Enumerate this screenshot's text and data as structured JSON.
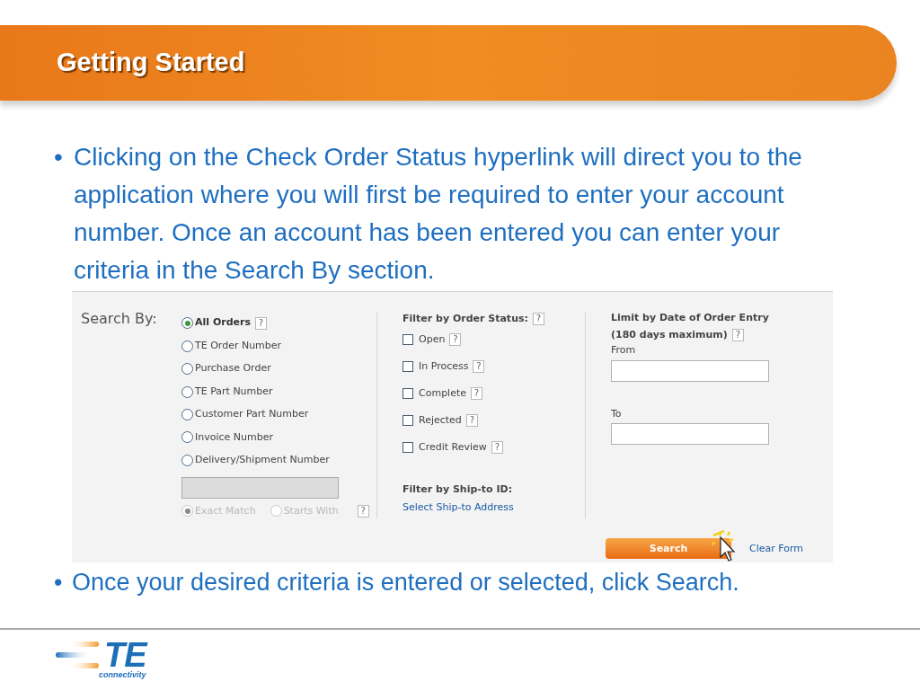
{
  "title": "Getting Started",
  "bullets": [
    {
      "mark": "•",
      "text": "Clicking on the Check Order Status hyperlink will direct you to the application where you will first be required to enter your account number.  Once an account has been entered you can enter your criteria in the Search By section."
    },
    {
      "mark": "•",
      "text": "Once your desired criteria is entered or selected, click Search."
    }
  ],
  "form": {
    "search_by": {
      "label": "Search By:",
      "options": [
        {
          "label": "All Orders",
          "selected": true,
          "help": "?"
        },
        {
          "label": "TE Order Number",
          "selected": false
        },
        {
          "label": "Purchase Order",
          "selected": false
        },
        {
          "label": "TE Part Number",
          "selected": false
        },
        {
          "label": "Customer Part Number",
          "selected": false
        },
        {
          "label": "Invoice Number",
          "selected": false
        },
        {
          "label": "Delivery/Shipment Number",
          "selected": false
        }
      ],
      "field": {
        "disabled": true
      },
      "match": {
        "disabled": true,
        "help": "?",
        "options": [
          {
            "label": "Exact Match",
            "selected": true
          },
          {
            "label": "Starts With",
            "selected": false
          }
        ]
      }
    },
    "status": {
      "label": "Filter by Order Status:",
      "help": "?",
      "options": [
        {
          "label": "Open",
          "checked": false,
          "help": "?"
        },
        {
          "label": "In Process",
          "checked": false,
          "help": "?"
        },
        {
          "label": "Complete",
          "checked": false,
          "help": "?"
        },
        {
          "label": "Rejected",
          "checked": false,
          "help": "?"
        },
        {
          "label": "Credit Review",
          "checked": false,
          "help": "?"
        }
      ]
    },
    "ship_to": {
      "label": "Filter by Ship-to ID:",
      "link": "Select Ship-to Address"
    },
    "date": {
      "label_1": "Limit by Date of Order Entry",
      "label_2": "(180 days maximum)",
      "help": "?",
      "from_label": "From",
      "to_label": "To"
    },
    "search_button": "Search",
    "clear_link": "Clear Form"
  },
  "logo": {
    "mark": "TE",
    "tagline": "connectivity"
  }
}
